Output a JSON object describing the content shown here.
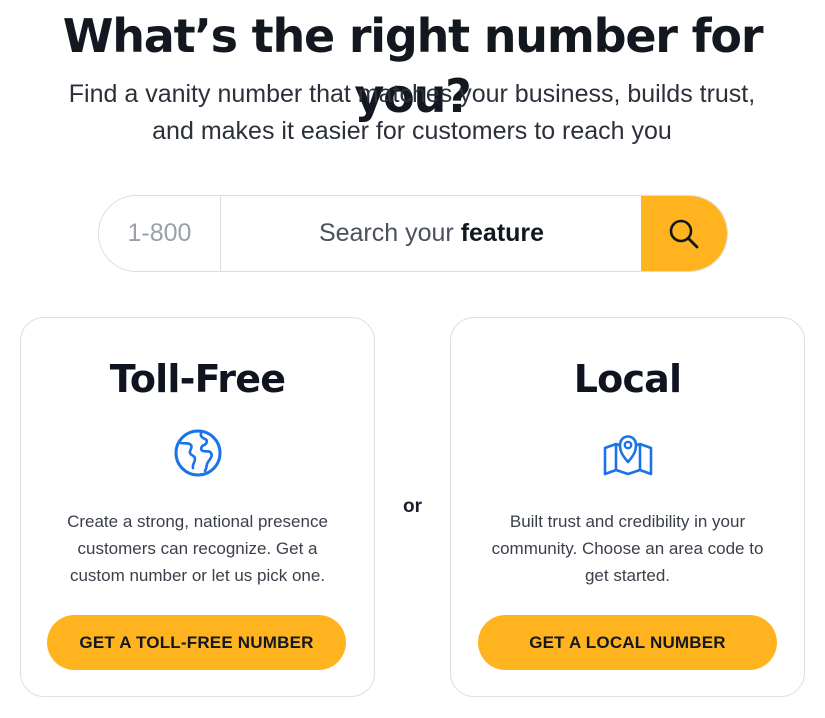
{
  "header": {
    "title": "What’s the right number for you?",
    "subtitle": "Find a vanity number that matches your business, builds trust, and makes it easier for customers to reach you"
  },
  "search": {
    "prefix": "1-800",
    "placeholder_lead": "Search your ",
    "placeholder_emphasis": "feature",
    "button_icon": "search-icon"
  },
  "separator": "or",
  "cards": {
    "tollfree": {
      "title": "Toll-Free",
      "icon": "globe-icon",
      "description": "Create a strong, national presence customers can recognize. Get a custom number or let us pick one.",
      "cta": "GET A TOLL-FREE NUMBER"
    },
    "local": {
      "title": "Local",
      "icon": "map-pin-icon",
      "description": "Built trust and credibility in your community. Choose an area code to get started.",
      "cta": "GET A LOCAL NUMBER"
    }
  },
  "colors": {
    "accent": "#ffb41f",
    "icon_blue": "#1a73e8",
    "heading": "#13171f"
  }
}
